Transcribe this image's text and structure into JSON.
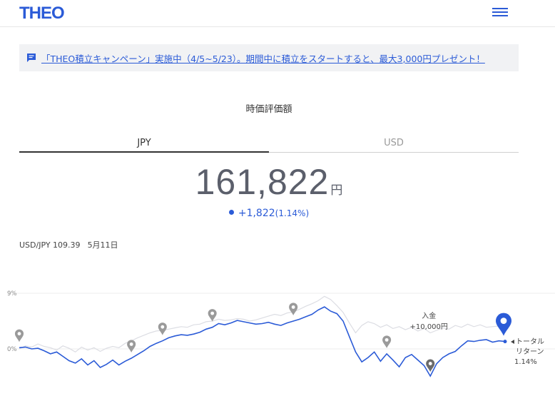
{
  "header": {
    "logo": "THEO",
    "menu_icon": "hamburger-menu-icon"
  },
  "banner": {
    "icon": "chat-message-icon",
    "text": "「THEO積立キャンペーン」実施中（4/5~5/23）。期間中に積立をスタートすると、最大3,000円プレゼント！"
  },
  "valuation": {
    "title": "時価評価額",
    "tabs": [
      {
        "label": "JPY",
        "active": true
      },
      {
        "label": "USD",
        "active": false
      }
    ],
    "value": "161,822",
    "unit": "円",
    "change": "+1,822",
    "change_pct": "(1.14%)"
  },
  "fx": {
    "rate": "USD/JPY 109.39",
    "date": "5月11日"
  },
  "chart_data": {
    "type": "line",
    "y_ticks": [
      "9%",
      "0%"
    ],
    "ylim": [
      -5,
      9
    ],
    "colors": {
      "series": "#2b5bd7",
      "benchmark": "#dcdde3",
      "marker": "#9a9a9a"
    },
    "series": [
      {
        "values": [
          0.2,
          0.3,
          0.0,
          0.1,
          -0.3,
          -0.8,
          -0.5,
          -1.2,
          -1.9,
          -2.3,
          -1.6,
          -2.6,
          -1.9,
          -3.0,
          -2.5,
          -1.8,
          -2.6,
          -2.0,
          -1.5,
          -0.9,
          -0.3,
          0.4,
          0.9,
          1.3,
          1.8,
          2.1,
          2.3,
          2.2,
          2.4,
          2.7,
          3.2,
          3.5,
          4.1,
          3.9,
          4.2,
          4.6,
          4.4,
          4.2,
          4.0,
          4.1,
          4.3,
          4.0,
          3.8,
          4.2,
          4.5,
          4.8,
          5.2,
          5.6,
          6.3,
          6.8,
          6.1,
          5.7,
          4.5,
          2.0,
          -0.5,
          -2.1,
          -1.4,
          -0.5,
          -2.0,
          -0.8,
          -1.8,
          -2.9,
          -1.4,
          -0.9,
          -1.8,
          -2.7,
          -4.4,
          -2.4,
          -1.4,
          -0.8,
          -0.4,
          0.5,
          1.3,
          1.2,
          1.4,
          1.5,
          1.1,
          1.3,
          1.2
        ],
        "dates_hidden": true
      },
      {
        "values": [
          0.0,
          0.5,
          0.3,
          0.8,
          0.4,
          0.2,
          -0.2,
          0.5,
          0.1,
          -0.5,
          0.3,
          -0.2,
          0.2,
          -0.4,
          0.1,
          0.4,
          0.2,
          0.9,
          1.3,
          1.8,
          2.2,
          2.6,
          2.9,
          3.0,
          3.2,
          3.4,
          3.6,
          3.5,
          3.9,
          4.0,
          4.4,
          4.5,
          4.8,
          4.6,
          4.7,
          4.9,
          4.8,
          4.5,
          4.7,
          5.0,
          5.3,
          5.6,
          5.4,
          5.8,
          6.0,
          6.4,
          6.9,
          7.3,
          7.8,
          8.5,
          8.0,
          7.0,
          5.9,
          4.2,
          2.6,
          3.8,
          4.4,
          4.1,
          3.5,
          3.9,
          3.3,
          3.6,
          3.1,
          3.5,
          2.9,
          3.3,
          2.6,
          3.0,
          3.4,
          3.2,
          3.8,
          3.5,
          4.0,
          3.6,
          3.9,
          3.5,
          3.6,
          3.7,
          3.7
        ]
      }
    ],
    "markers": [
      {
        "index": 0,
        "type": "past"
      },
      {
        "index": 18,
        "type": "past"
      },
      {
        "index": 23,
        "type": "past"
      },
      {
        "index": 31,
        "type": "past"
      },
      {
        "index": 44,
        "type": "past"
      },
      {
        "index": 59,
        "type": "past"
      },
      {
        "index": 66,
        "type": "deposit"
      },
      {
        "index": 78,
        "type": "current"
      }
    ],
    "annotations": {
      "deposit_label": "入金",
      "deposit_amount": "+10,000円",
      "total_return_line1": "トータル",
      "total_return_line2": "リターン",
      "total_return_value": "1.14%"
    }
  }
}
